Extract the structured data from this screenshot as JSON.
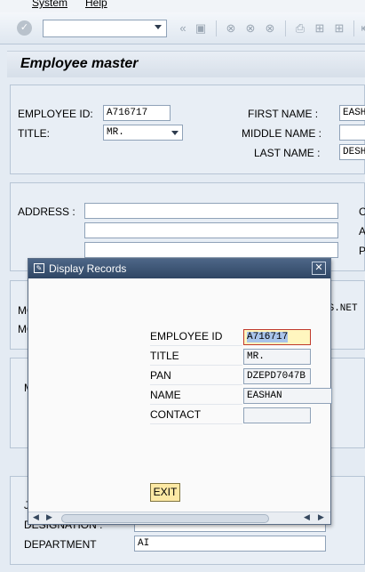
{
  "menu": {
    "items": [
      "System",
      "Help"
    ]
  },
  "toolbar": {
    "command_value": ""
  },
  "page": {
    "title": "Employee master"
  },
  "basic": {
    "employee_id_label": "EMPLOYEE ID:",
    "employee_id_value": "A716717",
    "title_label": "TITLE:",
    "title_value": "MR.",
    "first_name_label": "FIRST NAME :",
    "first_name_value": "EASH",
    "middle_name_label": "MIDDLE NAME :",
    "middle_name_value": "",
    "last_name_label": "LAST NAME :",
    "last_name_value": "DESH"
  },
  "address": {
    "label": "ADDRESS :",
    "lines": [
      "",
      "",
      ""
    ],
    "right_labels": [
      "C",
      "A",
      "P"
    ]
  },
  "contact": {
    "labels": [
      "MO",
      "MO"
    ],
    "email_fragment": "OS.NET"
  },
  "misc": {
    "label": "M"
  },
  "job": {
    "j_label": "J",
    "designation_label": "DESIGNATION :",
    "department_label": "DEPARTMENT",
    "department_value": "AI"
  },
  "dialog": {
    "title": "Display Records",
    "fields": [
      {
        "label": "EMPLOYEE ID",
        "value": "A716717"
      },
      {
        "label": "TITLE",
        "value": "MR."
      },
      {
        "label": "PAN",
        "value": "DZEPD7047B"
      },
      {
        "label": "NAME",
        "value": "EASHAN"
      },
      {
        "label": "CONTACT",
        "value": ""
      }
    ],
    "exit_label": "EXIT"
  },
  "colors": {
    "dialog_title_bg": "#3b5373",
    "exit_button_bg": "#fde9a4",
    "selection": "#a9c4ea"
  }
}
